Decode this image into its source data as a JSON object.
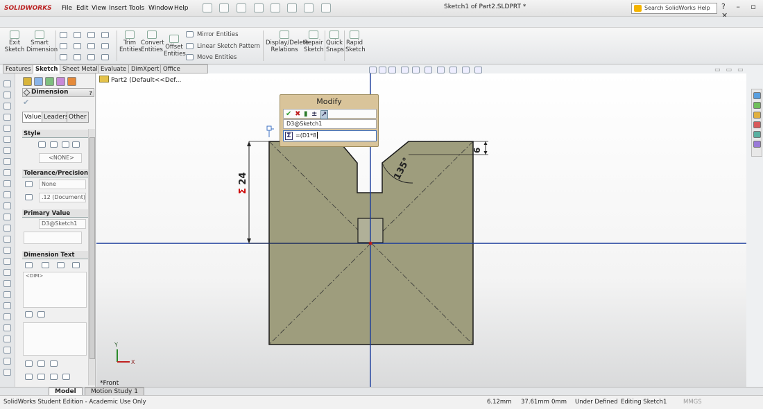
{
  "app": {
    "logo": "SOLIDWORKS",
    "menus": [
      "File",
      "Edit",
      "View",
      "Insert",
      "Tools",
      "Window",
      "Help"
    ],
    "document_title": "Sketch1 of Part2.SLDPRT *",
    "search_placeholder": "Search SolidWorks Help"
  },
  "ribbon": {
    "exit_sketch": [
      "Exit",
      "Sketch"
    ],
    "smart_dimension": [
      "Smart",
      "Dimension"
    ],
    "trim_entities": [
      "Trim",
      "Entities"
    ],
    "convert_entities": [
      "Convert",
      "Entities"
    ],
    "offset_entities": [
      "Offset",
      "Entities"
    ],
    "mirror_entities": "Mirror Entities",
    "linear_sketch_pattern": "Linear Sketch Pattern",
    "move_entities": "Move Entities",
    "display_delete_relations": [
      "Display/Delete",
      "Relations"
    ],
    "repair_sketch": [
      "Repair",
      "Sketch"
    ],
    "quick_snaps": [
      "Quick",
      "Snaps"
    ],
    "rapid_sketch": [
      "Rapid",
      "Sketch"
    ]
  },
  "cmd_tabs": [
    "Features",
    "Sketch",
    "Sheet Metal",
    "Evaluate",
    "DimXpert",
    "Office Products"
  ],
  "property_manager": {
    "title": "Dimension",
    "help": "?",
    "tabs": [
      "Value",
      "Leaders",
      "Other"
    ],
    "style_header": "Style",
    "style_value": "<NONE>",
    "tolerance_header": "Tolerance/Precision",
    "tolerance_value": "None",
    "precision_value": ".12 (Document)",
    "primary_value_header": "Primary Value",
    "primary_value_name": "D3@Sketch1",
    "dimension_text_header": "Dimension Text",
    "dimension_text_value": "<DIM>"
  },
  "feature_tree": {
    "root": "Part2  (Default<<Def..."
  },
  "modify_dialog": {
    "title": "Modify",
    "dim_name": "D3@Sketch1",
    "equation_symbol": "Σ",
    "value": "=(D1*8"
  },
  "dimensions": {
    "height": "24",
    "height_symbol": "Σ",
    "angle": "135°",
    "notch_depth": "6"
  },
  "view": {
    "orientation": "*Front",
    "triad_y": "Y",
    "triad_x": "X"
  },
  "bottom_tabs": [
    "Model",
    "Motion Study 1"
  ],
  "status": {
    "edition": "SolidWorks Student Edition - Academic Use Only",
    "x": "6.12mm",
    "y": "37.61mm",
    "z": "0mm",
    "state": "Under Defined",
    "editing": "Editing Sketch1",
    "units": "MMGS"
  },
  "colors": {
    "part_fill": "#9e9d7d",
    "sketch_edge": "#1a1a1a",
    "axis_blue": "#1a3c9c",
    "modify_bg": "#d9c49a"
  }
}
